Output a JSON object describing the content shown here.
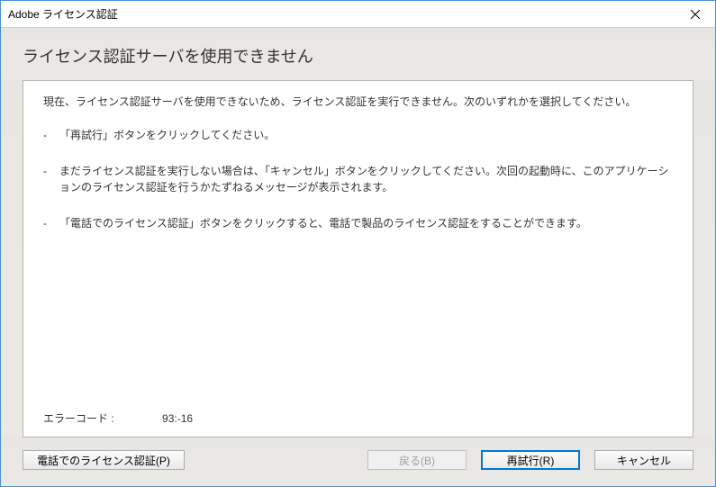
{
  "titlebar": {
    "title": "Adobe ライセンス認証"
  },
  "heading": "ライセンス認証サーバを使用できません",
  "intro": "現在、ライセンス認証サーバを使用できないため、ライセンス認証を実行できません。次のいずれかを選択してください。",
  "bullets": [
    "「再試行」ボタンをクリックしてください。",
    "まだライセンス認証を実行しない場合は、「キャンセル」ボタンをクリックしてください。次回の起動時に、このアプリケーションのライセンス認証を行うかたずねるメッセージが表示されます。",
    "「電話でのライセンス認証」ボタンをクリックすると、電話で製品のライセンス認証をすることができます。"
  ],
  "errorCode": {
    "label": "エラーコード :",
    "value": "93:-16"
  },
  "buttons": {
    "phone": "電話でのライセンス認証(P)",
    "back": "戻る(B)",
    "retry": "再試行(R)",
    "cancel": "キャンセル"
  }
}
